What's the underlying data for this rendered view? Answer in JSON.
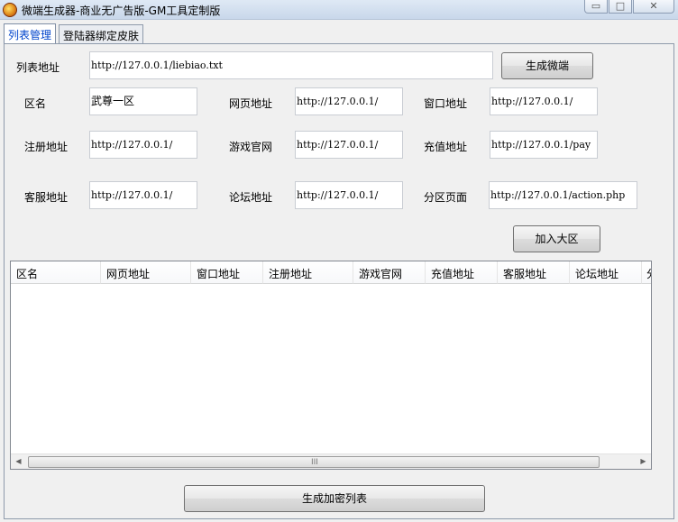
{
  "window": {
    "title": "微端生成器-商业无广告版-GM工具定制版",
    "min_glyph": "▭",
    "max_glyph": "□",
    "close_glyph": "✕",
    "icon": "app-gem-icon"
  },
  "tabs": [
    {
      "label": "列表管理",
      "active": true
    },
    {
      "label": "登陆器绑定皮肤",
      "active": false
    }
  ],
  "form": {
    "list_url_label": "列表地址",
    "list_url_value": "http://127.0.0.1/liebiao.txt",
    "generate_button": "生成微端",
    "zone_name_label": "区名",
    "zone_name_value": "武尊一区",
    "webpage_label": "网页地址",
    "webpage_value": "http://127.0.0.1/",
    "window_label": "窗口地址",
    "window_value": "http://127.0.0.1/",
    "register_label": "注册地址",
    "register_value": "http://127.0.0.1/",
    "official_label": "游戏官网",
    "official_value": "http://127.0.0.1/",
    "recharge_label": "充值地址",
    "recharge_value": "http://127.0.0.1/pay",
    "service_label": "客服地址",
    "service_value": "http://127.0.0.1/",
    "forum_label": "论坛地址",
    "forum_value": "http://127.0.0.1/",
    "partition_label": "分区页面",
    "partition_value": "http://127.0.0.1/action.php",
    "add_button": "加入大区"
  },
  "table": {
    "columns": [
      "区名",
      "网页地址",
      "窗口地址",
      "注册地址",
      "游戏官网",
      "充值地址",
      "客服地址",
      "论坛地址",
      "分"
    ],
    "rows": [],
    "scroll_left": "◀",
    "scroll_right": "▶",
    "grip": "III"
  },
  "footer": {
    "encrypt_button": "生成加密列表"
  },
  "colors": {
    "active_tab_text": "#0044cc",
    "window_bg": "#f0f0f0",
    "titlebar": "#c8d7ea"
  }
}
